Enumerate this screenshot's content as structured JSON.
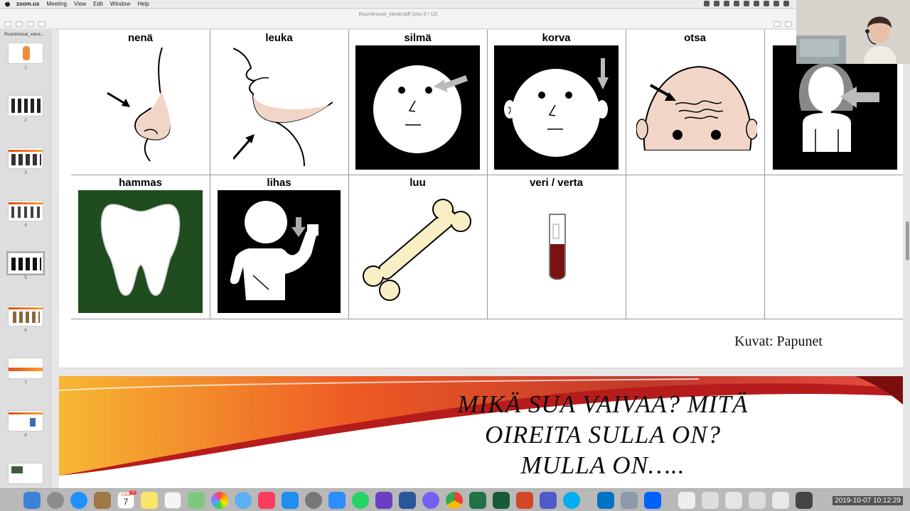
{
  "menubar": {
    "app": "zoom.us",
    "items": [
      "Meeting",
      "View",
      "Edit",
      "Window",
      "Help"
    ]
  },
  "window": {
    "doc_title": "Ruumiinosat_vaivat.pdf (sivu 5 / 12)"
  },
  "sidebar": {
    "file_label": "Ruumiinosat_vaiva...",
    "pages": [
      "1",
      "2",
      "3",
      "4",
      "5",
      "6",
      "7",
      "8"
    ],
    "selected_page": "5"
  },
  "grid": {
    "row1": [
      "nenä",
      "leuka",
      "silmä",
      "korva",
      "otsa",
      ""
    ],
    "row2": [
      "hammas",
      "lihas",
      "luu",
      "veri / verta",
      "",
      ""
    ]
  },
  "credit": "Kuvat: Papunet",
  "slide2": {
    "title_lines": [
      "MIKÄ SUA VAIVAA? MITÄ",
      "OIREITA SULLA ON?",
      "MULLA ON….."
    ]
  },
  "dock": {
    "calendar_month": "LOKA",
    "calendar_day": "7",
    "calendar_badge": "12",
    "datetime": "2019-10-07  10:12:29"
  },
  "colors": {
    "tooth_bg": "#1f4d1f",
    "blood": "#7a1212",
    "bone": "#f8efc5",
    "skin": "#f1d6c8"
  }
}
